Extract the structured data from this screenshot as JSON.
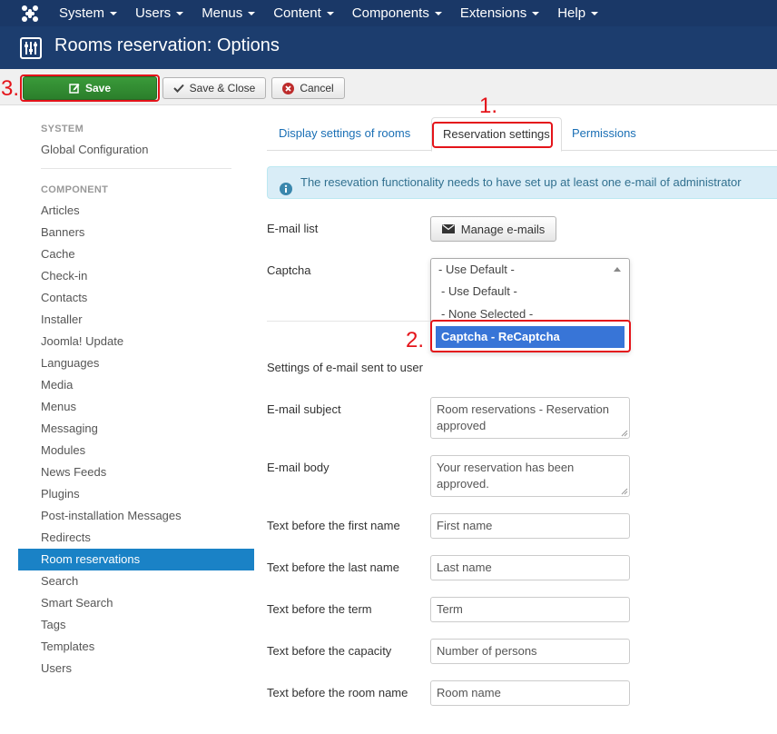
{
  "topnav": {
    "menu": [
      "System",
      "Users",
      "Menus",
      "Content",
      "Components",
      "Extensions",
      "Help"
    ]
  },
  "header": {
    "title": "Rooms reservation: Options"
  },
  "toolbar": {
    "save": "Save",
    "save_close": "Save & Close",
    "cancel": "Cancel"
  },
  "annotations": {
    "a1": "1.",
    "a2": "2.",
    "a3": "3."
  },
  "sidebar": {
    "system_header": "SYSTEM",
    "global_config": "Global Configuration",
    "component_header": "COMPONENT",
    "items": [
      "Articles",
      "Banners",
      "Cache",
      "Check-in",
      "Contacts",
      "Installer",
      "Joomla! Update",
      "Languages",
      "Media",
      "Menus",
      "Messaging",
      "Modules",
      "News Feeds",
      "Plugins",
      "Post-installation Messages",
      "Redirects",
      "Room reservations",
      "Search",
      "Smart Search",
      "Tags",
      "Templates",
      "Users"
    ],
    "active_item": "Room reservations"
  },
  "tabs": [
    "Display settings of rooms",
    "Reservation settings",
    "Permissions"
  ],
  "active_tab": "Reservation settings",
  "alert": "The resevation functionality needs to have set up at least one e-mail of administrator",
  "form": {
    "email_list_label": "E-mail list",
    "manage_emails": "Manage e-mails",
    "captcha_label": "Captcha",
    "captcha_current": "- Use Default -",
    "captcha_options": [
      "- Use Default -",
      "- None Selected -",
      "Captcha - ReCaptcha"
    ],
    "captcha_highlighted": "Captcha - ReCaptcha",
    "email_section": "Settings of e-mail sent to user",
    "subject_label": "E-mail subject",
    "subject_value": "Room reservations - Reservation approved",
    "body_label": "E-mail body",
    "body_value": "Your reservation has been approved.",
    "first_name_label": "Text before the first name",
    "first_name_value": "First name",
    "last_name_label": "Text before the last name",
    "last_name_value": "Last name",
    "term_label": "Text before the term",
    "term_value": "Term",
    "capacity_label": "Text before the capacity",
    "capacity_value": "Number of persons",
    "room_label": "Text before the room name",
    "room_value": "Room name"
  },
  "colors": {
    "nav": "#1a3867",
    "header": "#1c3d6e",
    "accent": "#1a82c6",
    "save": "#2f8c2f",
    "annotation": "#e4141a"
  }
}
